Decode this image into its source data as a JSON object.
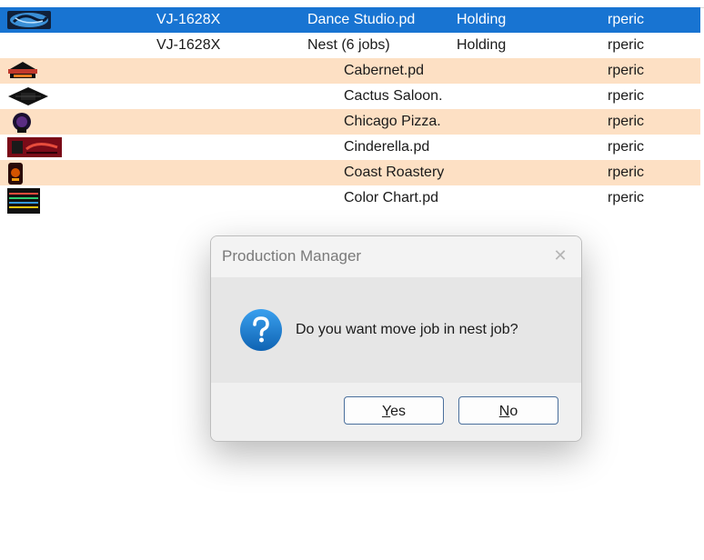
{
  "jobs": [
    {
      "printer": "VJ-1628X",
      "name": "Dance Studio.pd",
      "status": "Holding",
      "user": "rperic",
      "selected": true,
      "thumb": "dance-studio-thumbnail-icon"
    },
    {
      "printer": "VJ-1628X",
      "name": "Nest (6 jobs)",
      "status": "Holding",
      "user": "rperic",
      "selected": false,
      "thumb": ""
    },
    {
      "printer": "",
      "name": "Cabernet.pd",
      "status": "",
      "user": "rperic",
      "child": true,
      "thumb": "cabernet-thumbnail-icon"
    },
    {
      "printer": "",
      "name": "Cactus Saloon.",
      "status": "",
      "user": "rperic",
      "child": true,
      "thumb": "cactus-saloon-thumbnail-icon"
    },
    {
      "printer": "",
      "name": "Chicago Pizza.",
      "status": "",
      "user": "rperic",
      "child": true,
      "thumb": "chicago-pizza-thumbnail-icon"
    },
    {
      "printer": "",
      "name": "Cinderella.pd",
      "status": "",
      "user": "rperic",
      "child": true,
      "thumb": "cinderella-thumbnail-icon"
    },
    {
      "printer": "",
      "name": "Coast Roastery",
      "status": "",
      "user": "rperic",
      "child": true,
      "thumb": "coast-roastery-thumbnail-icon"
    },
    {
      "printer": "",
      "name": "Color Chart.pd",
      "status": "",
      "user": "rperic",
      "child": true,
      "thumb": "color-chart-thumbnail-icon"
    }
  ],
  "dialog": {
    "title": "Production Manager",
    "close_glyph": "✕",
    "icon": "question-icon",
    "message": "Do you want move job in nest job?",
    "yes_mnemonic": "Y",
    "yes_rest": "es",
    "no_mnemonic": "N",
    "no_rest": "o"
  },
  "colors": {
    "selected_row": "#1874d2",
    "alt_row": "#fde0c4",
    "button_border": "#4a6f9c",
    "question_icon": "#1c79c8"
  }
}
